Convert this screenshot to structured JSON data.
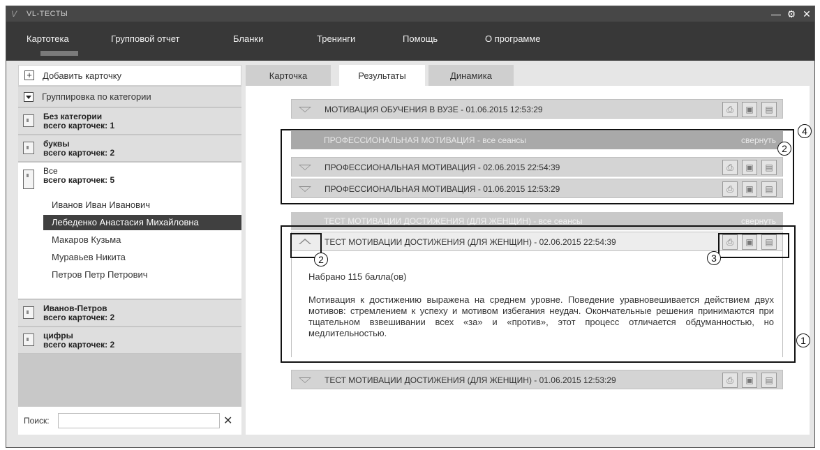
{
  "window": {
    "title": "VL-ТЕСТЫ",
    "logo": "V"
  },
  "menu": [
    "Картотека",
    "Групповой отчет",
    "Бланки",
    "Тренинги",
    "Помощь",
    "О программе"
  ],
  "left": {
    "add_card": "Добавить карточку",
    "grouping": "Группировка по категории",
    "categories": [
      {
        "name": "Без категории",
        "count": "всего карточек: 1"
      },
      {
        "name": "буквы",
        "count": "всего карточек: 2"
      },
      {
        "name": "Все",
        "count": "всего карточек: 5"
      },
      {
        "name": "Иванов-Петров",
        "count": "всего карточек: 2"
      },
      {
        "name": "цифры",
        "count": "всего карточек: 2"
      }
    ],
    "people": [
      "Иванов Иван Иванович",
      "Лебеденко Анастасия  Михайловна",
      "Макаров Кузьма",
      "Муравьев Никита",
      "Петров Петр Петрович"
    ],
    "search_label": "Поиск:",
    "search_value": "",
    "clear": "✕"
  },
  "tabs": [
    "Карточка",
    "Результаты",
    "Динамика"
  ],
  "results": {
    "row1": "МОТИВАЦИЯ ОБУЧЕНИЯ В ВУЗЕ - 01.06.2015  12:53:29",
    "group1": "ПРОФЕССИОНАЛЬНАЯ МОТИВАЦИЯ - все сеансы",
    "collapse": "свернуть",
    "row2": "ПРОФЕССИОНАЛЬНАЯ МОТИВАЦИЯ  - 02.06.2015  22:54:39",
    "row3": "ПРОФЕССИОНАЛЬНАЯ МОТИВАЦИЯ  - 01.06.2015  12:53:29",
    "group2": "ТЕСТ МОТИВАЦИИ ДОСТИЖЕНИЯ (ДЛЯ ЖЕНЩИН) - все сеансы",
    "row4": "ТЕСТ МОТИВАЦИИ ДОСТИЖЕНИЯ (ДЛЯ ЖЕНЩИН) - 02.06.2015  22:54:39",
    "score": "Набрано 115 балла(ов)",
    "description": "Мотивация к достижению выражена на среднем уровне. Поведение уравновешивается действием двух мотивов: стремлением к успеху и мотивом избегания неудач. Окончательные решения принимаются при тщательном взвешивании всех «за» и «против», этот процесс отличается обдуманностью, но медлительностью.",
    "row5": "ТЕСТ МОТИВАЦИИ ДОСТИЖЕНИЯ (ДЛЯ ЖЕНЩИН) - 01.06.2015  12:53:29"
  },
  "icons": {
    "print": "printer-icon",
    "save": "floppy-icon",
    "delete": "trash-icon"
  },
  "annotations": [
    "1",
    "2",
    "3",
    "4"
  ]
}
